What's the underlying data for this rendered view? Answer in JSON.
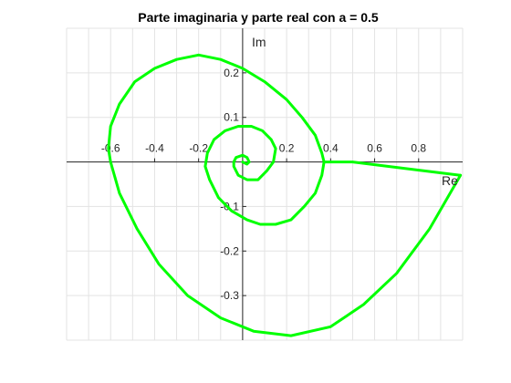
{
  "chart_data": {
    "type": "line",
    "title": "Parte imaginaria y parte real con a = 0.5",
    "xlabel": "Re",
    "ylabel": "Im",
    "xlim": [
      -0.8,
      1.0
    ],
    "ylim": [
      -0.4,
      0.3
    ],
    "x_ticks": [
      -0.6,
      -0.4,
      -0.2,
      0.2,
      0.4,
      0.6,
      0.8
    ],
    "x_tick_labels": [
      "-0.6",
      "-0.4",
      "-0.2",
      "0.2",
      "0.4",
      "0.6",
      "0.8"
    ],
    "y_ticks": [
      0.2,
      0.1,
      -0.1,
      -0.2,
      -0.3
    ],
    "y_tick_labels": [
      "0.2",
      "0.1",
      "-0.1",
      "-0.2",
      "-0.3"
    ],
    "grid": true,
    "line_color": "#00ff00",
    "series": [
      {
        "x": [
          0.99,
          0.85,
          0.7,
          0.55,
          0.4,
          0.22,
          0.05,
          -0.1,
          -0.25,
          -0.38,
          -0.48,
          -0.56,
          -0.6,
          -0.61,
          -0.6,
          -0.56,
          -0.49,
          -0.4,
          -0.3,
          -0.2,
          -0.1,
          0.0,
          0.1,
          0.2,
          0.27,
          0.33,
          0.36,
          0.37,
          0.36,
          0.33,
          0.28,
          0.22,
          0.15,
          0.08,
          0.02,
          -0.05,
          -0.11,
          -0.15,
          -0.17,
          -0.16,
          -0.13,
          -0.08,
          -0.02,
          0.04,
          0.09,
          0.13,
          0.15,
          0.14,
          0.11,
          0.07,
          0.02,
          -0.02,
          -0.04,
          -0.04,
          -0.03,
          0.0,
          0.02,
          0.03,
          0.02,
          0.0
        ],
        "y": [
          -0.03,
          -0.15,
          -0.25,
          -0.32,
          -0.37,
          -0.39,
          -0.38,
          -0.35,
          -0.3,
          -0.23,
          -0.15,
          -0.07,
          0.0,
          0.03,
          0.08,
          0.13,
          0.18,
          0.21,
          0.23,
          0.24,
          0.23,
          0.21,
          0.18,
          0.14,
          0.1,
          0.06,
          0.02,
          0.0,
          -0.03,
          -0.07,
          -0.1,
          -0.13,
          -0.14,
          -0.14,
          -0.13,
          -0.11,
          -0.08,
          -0.04,
          -0.01,
          0.02,
          0.05,
          0.07,
          0.08,
          0.08,
          0.07,
          0.05,
          0.03,
          0.0,
          -0.02,
          -0.04,
          -0.04,
          -0.03,
          -0.01,
          0.0,
          0.01,
          0.015,
          0.01,
          0.0,
          -0.005,
          0.0
        ]
      },
      {
        "x": [
          0.37,
          0.5,
          0.99
        ],
        "y": [
          0.0,
          0.0,
          -0.03
        ]
      }
    ]
  }
}
